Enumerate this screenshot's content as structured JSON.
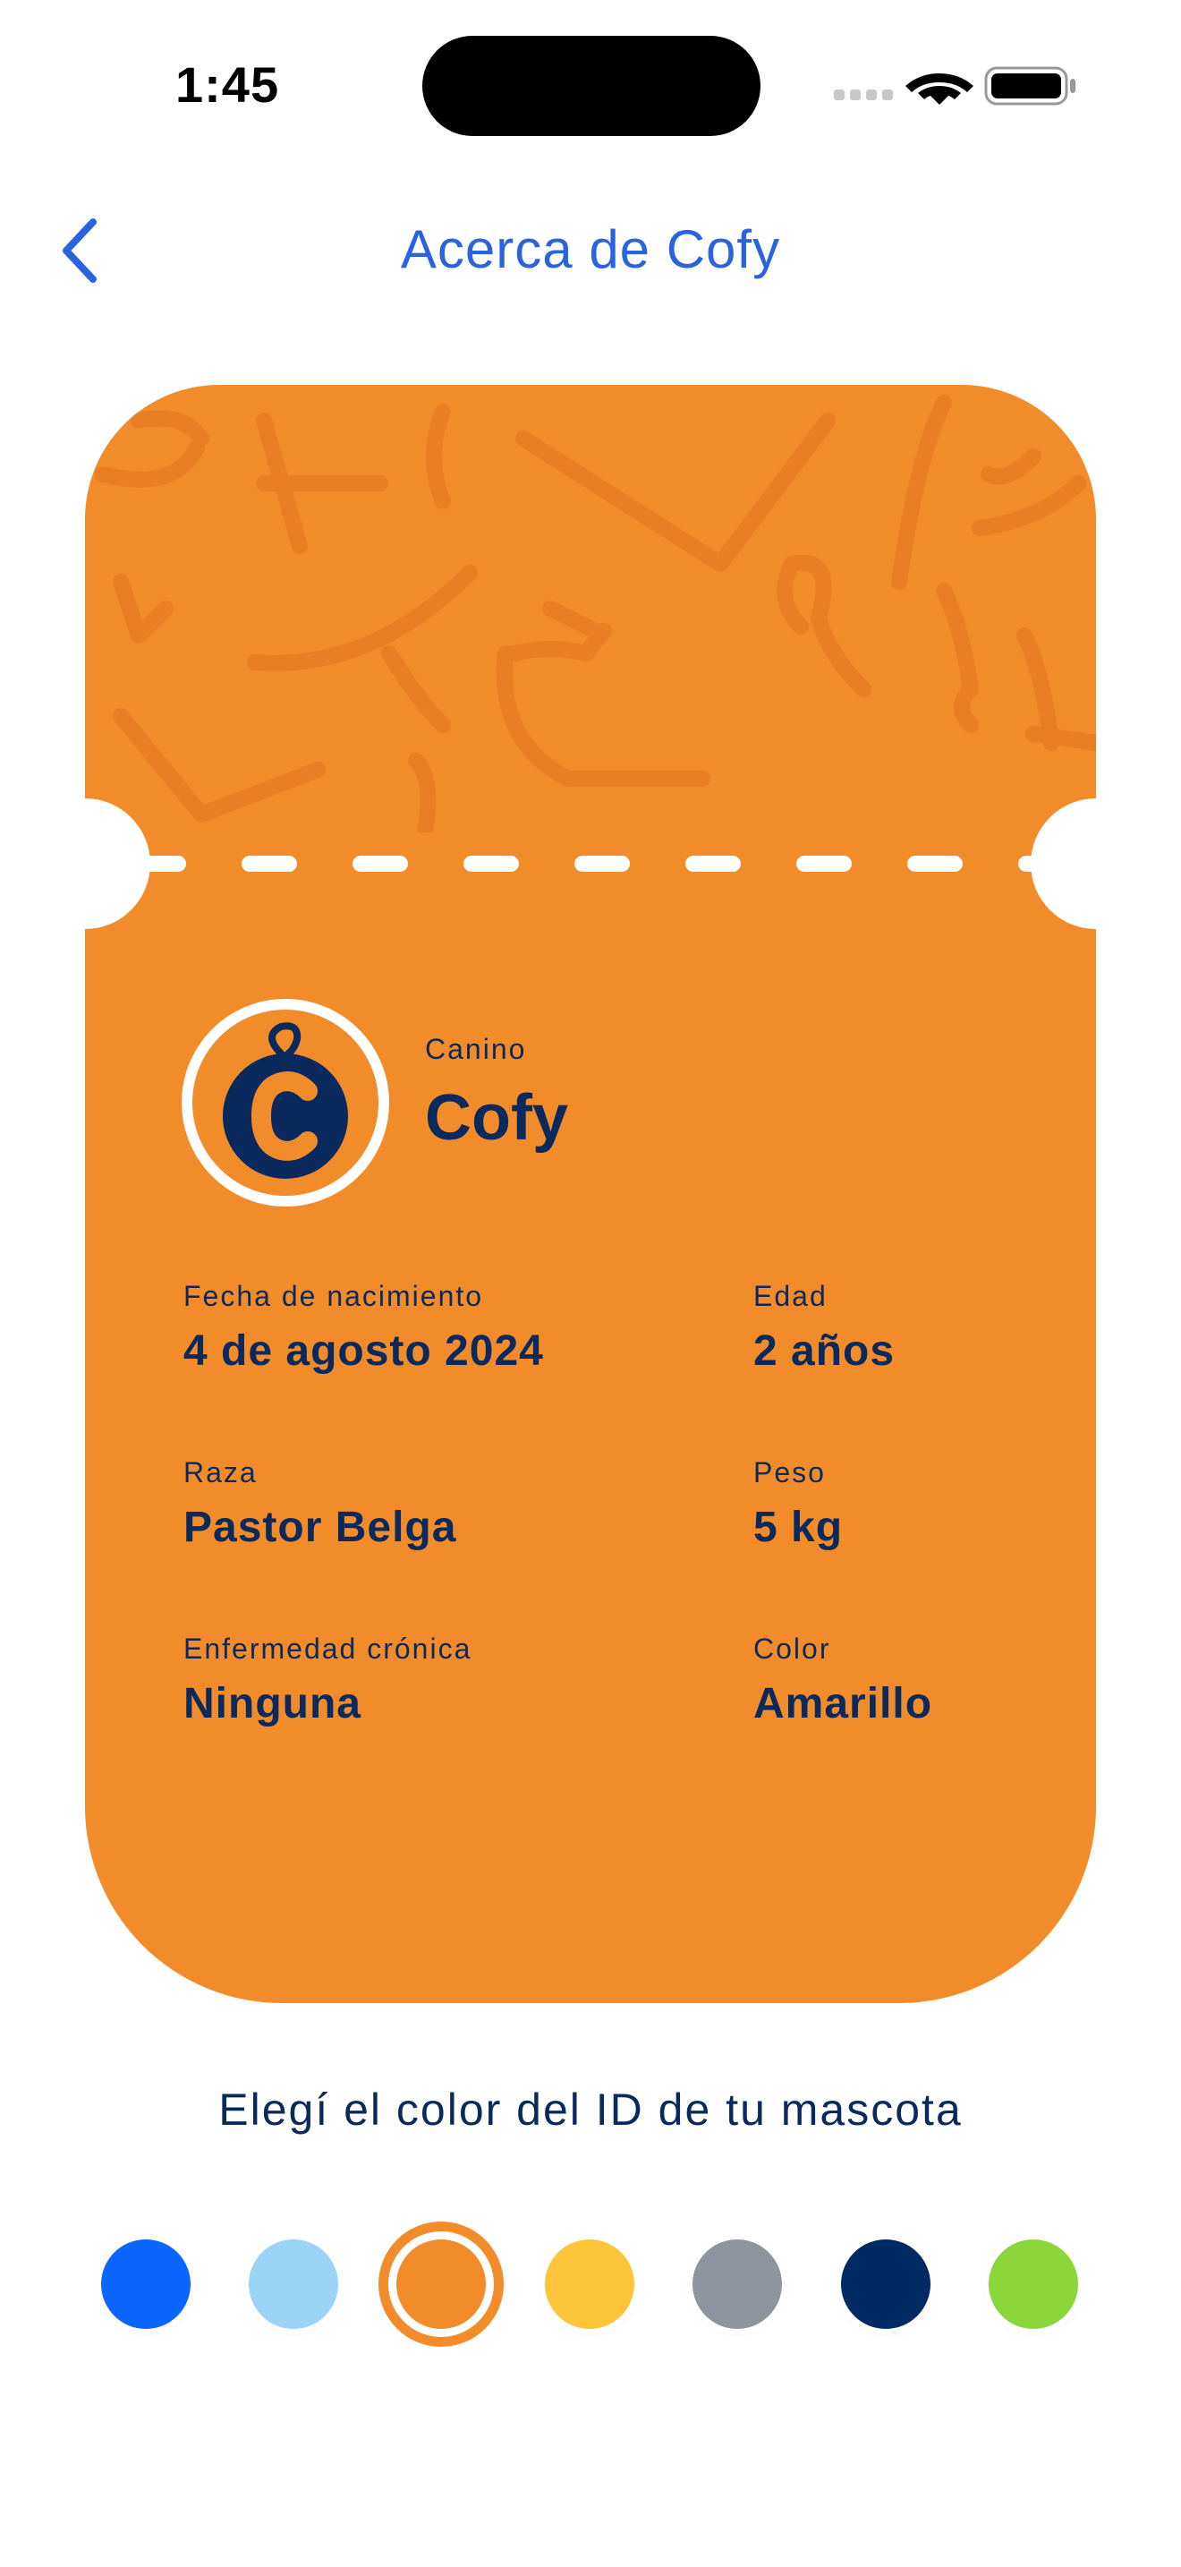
{
  "status_bar": {
    "time": "1:45"
  },
  "nav": {
    "title": "Acerca de Cofy"
  },
  "card": {
    "species": "Canino",
    "name": "Cofy",
    "fields": [
      {
        "label": "Fecha de nacimiento",
        "value": "4 de agosto 2024"
      },
      {
        "label": "Edad",
        "value": "2 años"
      },
      {
        "label": "Raza",
        "value": "Pastor Belga"
      },
      {
        "label": "Peso",
        "value": "5 kg"
      },
      {
        "label": "Enfermedad crónica",
        "value": "Ninguna"
      },
      {
        "label": "Color",
        "value": "Amarillo"
      }
    ],
    "background_color": "#F28B2A",
    "text_color": "#0A2A5E"
  },
  "color_picker": {
    "title": "Elegí el color del ID de tu mascota",
    "options": [
      "#0A66FF",
      "#9AD3F5",
      "#F28B2A",
      "#FFC53A",
      "#8E959E",
      "#002A62",
      "#8BD63A"
    ],
    "selected_index": 2
  },
  "icons": {
    "back": "chevron-left-icon",
    "avatar": "cofy-logo-icon",
    "signal": "cellular-signal-icon",
    "wifi": "wifi-icon",
    "battery": "battery-icon"
  }
}
